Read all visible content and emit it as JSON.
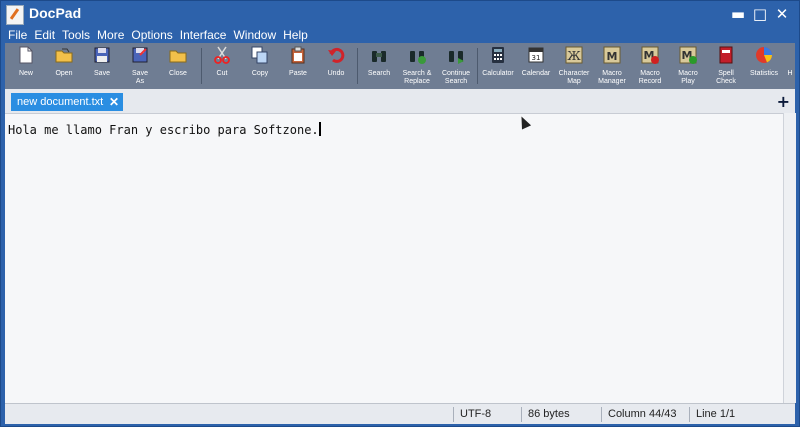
{
  "window": {
    "title": "DocPad",
    "minimize": "▬",
    "maximize": "□",
    "close": "✕"
  },
  "menu": [
    {
      "label": "File"
    },
    {
      "label": "Edit"
    },
    {
      "label": "Tools"
    },
    {
      "label": "More"
    },
    {
      "label": "Options"
    },
    {
      "label": "Interface"
    },
    {
      "label": "Window"
    },
    {
      "label": "Help"
    }
  ],
  "toolbar": [
    {
      "label": "New",
      "icon": "new-doc-icon"
    },
    {
      "label": "Open",
      "icon": "open-folder-icon"
    },
    {
      "label": "Save",
      "icon": "save-icon"
    },
    {
      "label": "Save\nAs",
      "icon": "save-as-icon"
    },
    {
      "label": "Close",
      "icon": "close-folder-icon"
    },
    {
      "label": "Cut",
      "icon": "scissors-icon"
    },
    {
      "label": "Copy",
      "icon": "copy-icon"
    },
    {
      "label": "Paste",
      "icon": "paste-icon"
    },
    {
      "label": "Undo",
      "icon": "undo-icon"
    },
    {
      "label": "Search",
      "icon": "binoculars-icon"
    },
    {
      "label": "Search &\nReplace",
      "icon": "search-replace-icon"
    },
    {
      "label": "Continue\nSearch",
      "icon": "continue-search-icon"
    },
    {
      "label": "Calculator",
      "icon": "calculator-icon"
    },
    {
      "label": "Calendar",
      "icon": "calendar-icon"
    },
    {
      "label": "Character\nMap",
      "icon": "character-map-icon"
    },
    {
      "label": "Macro\nManager",
      "icon": "macro-manager-icon"
    },
    {
      "label": "Macro\nRecord",
      "icon": "macro-record-icon"
    },
    {
      "label": "Macro\nPlay",
      "icon": "macro-play-icon"
    },
    {
      "label": "Spell\nCheck",
      "icon": "spell-check-icon"
    },
    {
      "label": "Statistics",
      "icon": "statistics-icon"
    },
    {
      "label": "H",
      "icon": "more-icon"
    }
  ],
  "tabs": [
    {
      "label": "new document.txt",
      "close": "✕"
    }
  ],
  "tab_add": "+",
  "editor": {
    "text": "Hola me llamo Fran y escribo para Softzone."
  },
  "status": {
    "encoding": "UTF-8",
    "size": "86 bytes",
    "column": "Column 44/43",
    "line": "Line 1/1"
  },
  "colors": {
    "titlebar": "#2d62ab",
    "toolbar": "#6f7d93",
    "tab_active": "#2a8ee2"
  }
}
